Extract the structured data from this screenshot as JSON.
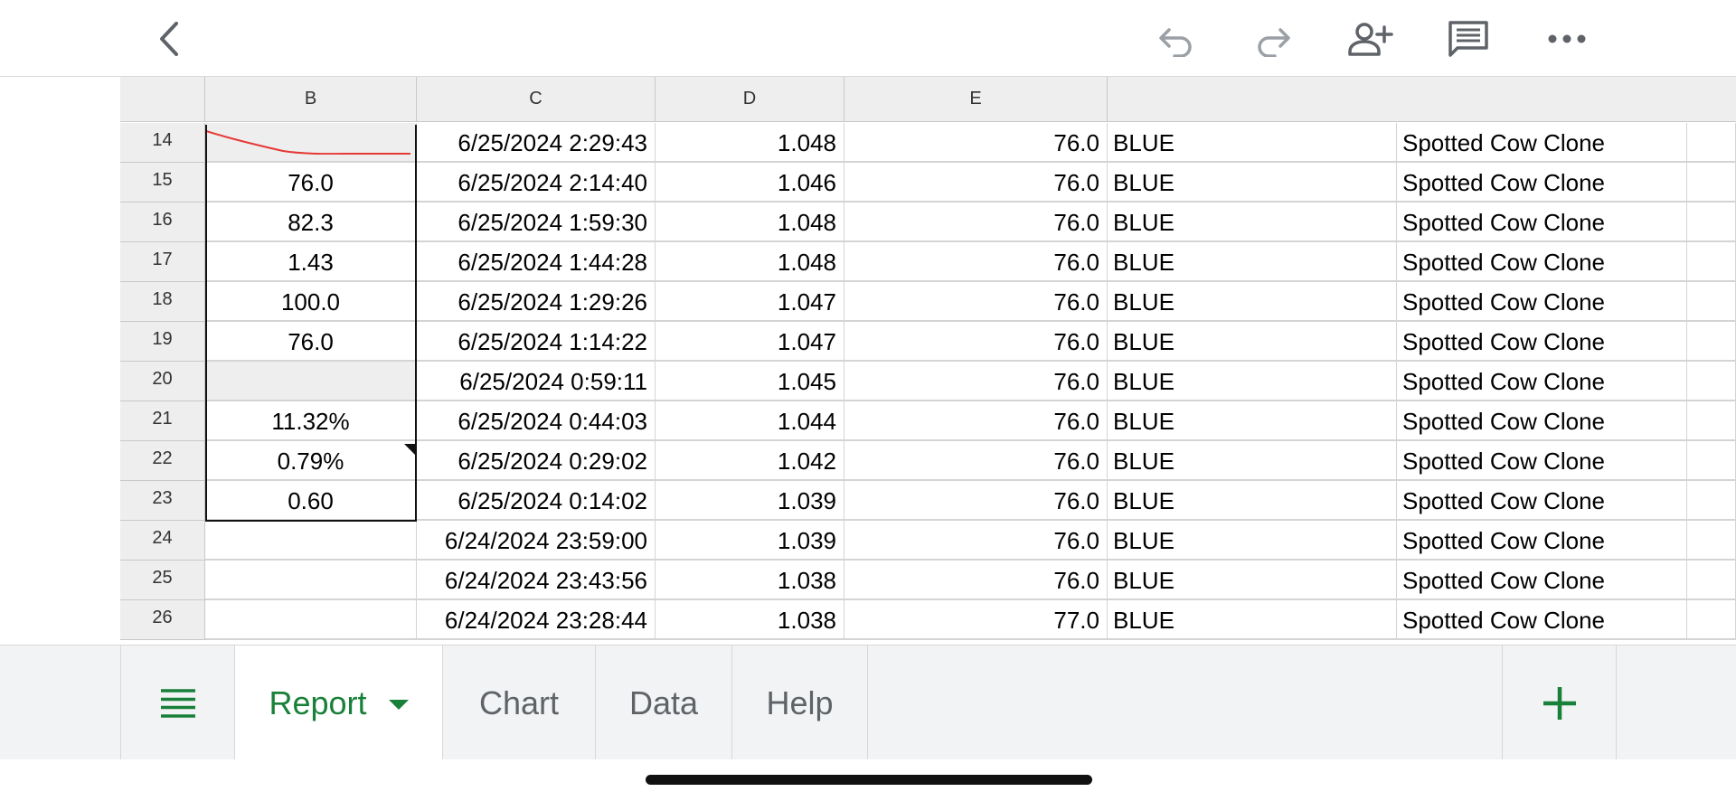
{
  "toolbar": {
    "back_icon": "chevron-left-icon",
    "undo_icon": "undo-icon",
    "redo_icon": "redo-icon",
    "share_icon": "add-person-icon",
    "comment_icon": "comment-icon",
    "more_icon": "more-horizontal-icon"
  },
  "columns": [
    "B",
    "C",
    "D",
    "E",
    ""
  ],
  "rows": [
    {
      "num": "14",
      "b": "",
      "c": "6/25/2024 2:29:43",
      "d": "1.048",
      "e": "76.0",
      "f": "BLUE",
      "g": "Spotted Cow Clone"
    },
    {
      "num": "15",
      "b": "76.0",
      "c": "6/25/2024 2:14:40",
      "d": "1.046",
      "e": "76.0",
      "f": "BLUE",
      "g": "Spotted Cow Clone"
    },
    {
      "num": "16",
      "b": "82.3",
      "c": "6/25/2024 1:59:30",
      "d": "1.048",
      "e": "76.0",
      "f": "BLUE",
      "g": "Spotted Cow Clone"
    },
    {
      "num": "17",
      "b": "1.43",
      "c": "6/25/2024 1:44:28",
      "d": "1.048",
      "e": "76.0",
      "f": "BLUE",
      "g": "Spotted Cow Clone"
    },
    {
      "num": "18",
      "b": "100.0",
      "c": "6/25/2024 1:29:26",
      "d": "1.047",
      "e": "76.0",
      "f": "BLUE",
      "g": "Spotted Cow Clone"
    },
    {
      "num": "19",
      "b": "76.0",
      "c": "6/25/2024 1:14:22",
      "d": "1.047",
      "e": "76.0",
      "f": "BLUE",
      "g": "Spotted Cow Clone"
    },
    {
      "num": "20",
      "b": "",
      "c": "6/25/2024 0:59:11",
      "d": "1.045",
      "e": "76.0",
      "f": "BLUE",
      "g": "Spotted Cow Clone"
    },
    {
      "num": "21",
      "b": "11.32%",
      "c": "6/25/2024 0:44:03",
      "d": "1.044",
      "e": "76.0",
      "f": "BLUE",
      "g": "Spotted Cow Clone"
    },
    {
      "num": "22",
      "b": "0.79%",
      "c": "6/25/2024 0:29:02",
      "d": "1.042",
      "e": "76.0",
      "f": "BLUE",
      "g": "Spotted Cow Clone"
    },
    {
      "num": "23",
      "b": "0.60",
      "c": "6/25/2024 0:14:02",
      "d": "1.039",
      "e": "76.0",
      "f": "BLUE",
      "g": "Spotted Cow Clone"
    },
    {
      "num": "24",
      "b": "",
      "c": "6/24/2024 23:59:00",
      "d": "1.039",
      "e": "76.0",
      "f": "BLUE",
      "g": "Spotted Cow Clone"
    },
    {
      "num": "25",
      "b": "",
      "c": "6/24/2024 23:43:56",
      "d": "1.038",
      "e": "76.0",
      "f": "BLUE",
      "g": "Spotted Cow Clone"
    },
    {
      "num": "26",
      "b": "",
      "c": "6/24/2024 23:28:44",
      "d": "1.038",
      "e": "77.0",
      "f": "BLUE",
      "g": "Spotted Cow Clone"
    }
  ],
  "tabs": {
    "menu_icon": "list-menu-icon",
    "items": [
      {
        "label": "Report",
        "active": true
      },
      {
        "label": "Chart",
        "active": false
      },
      {
        "label": "Data",
        "active": false
      },
      {
        "label": "Help",
        "active": false
      }
    ],
    "add_icon": "plus-icon"
  },
  "colors": {
    "accent": "#188038",
    "sparkline": "#e53935"
  }
}
